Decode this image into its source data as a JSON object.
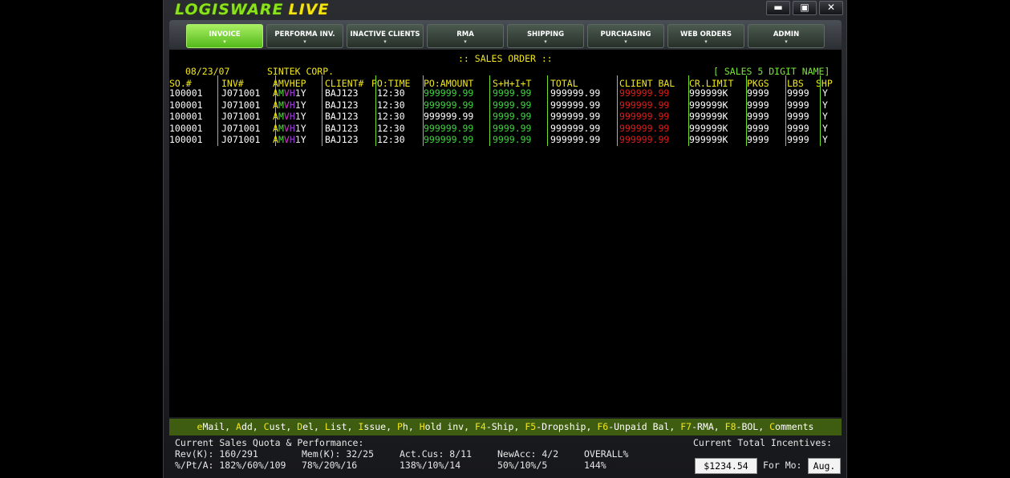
{
  "app": {
    "logo_part1": "LOGISWARE",
    "logo_part2": "LIVE"
  },
  "window_controls": {
    "minimize": "▬",
    "maximize": "▣",
    "close": "✕"
  },
  "nav_tabs": [
    {
      "label": "INVOICE",
      "active": true
    },
    {
      "label": "PERFORMA INV.",
      "active": false
    },
    {
      "label": "INACTIVE CLIENTS",
      "active": false
    },
    {
      "label": "RMA",
      "active": false
    },
    {
      "label": "SHIPPING",
      "active": false
    },
    {
      "label": "PURCHASING",
      "active": false
    },
    {
      "label": "WEB ORDERS",
      "active": false
    },
    {
      "label": "ADMIN",
      "active": false
    }
  ],
  "nav_arrow": "▾",
  "header": {
    "title": ":: SALES ORDER ::",
    "date": "08/23/07",
    "company": "SINTEK CORP.",
    "right": "[ SALES 5 DIGIT NAME]"
  },
  "table": {
    "columns": [
      "SO.#",
      "INV#",
      "AMVHEP",
      "CLIENT#",
      "PO:TIME",
      "PO:AMOUNT",
      "S+H+I+T",
      "TOTAL",
      "CLIENT BAL",
      "CR.LIMIT",
      "PKGS",
      "LBS",
      "SHP"
    ],
    "rows": [
      {
        "so": "100001",
        "inv": "J071001",
        "flags": [
          "A",
          "M",
          "V",
          "H",
          "1",
          "Y"
        ],
        "client": "BAJ123",
        "time": "12:30",
        "po_amount": "999999.99",
        "po_green": true,
        "shit": "9999.99",
        "total": "999999.99",
        "client_bal": "999999.99",
        "cr_limit": "999999K",
        "pkgs": "9999",
        "lbs": "9999",
        "shp": "Y"
      },
      {
        "so": "100001",
        "inv": "J071001",
        "flags": [
          "A",
          "M",
          "V",
          "H",
          "1",
          "Y"
        ],
        "client": "BAJ123",
        "time": "12:30",
        "po_amount": "999999.99",
        "po_green": true,
        "shit": "9999.99",
        "total": "999999.99",
        "client_bal": "999999.99",
        "cr_limit": "999999K",
        "pkgs": "9999",
        "lbs": "9999",
        "shp": "Y"
      },
      {
        "so": "100001",
        "inv": "J071001",
        "flags": [
          "A",
          "M",
          "V",
          "H",
          "1",
          "Y"
        ],
        "client": "BAJ123",
        "time": "12:30",
        "po_amount": "999999.99",
        "po_green": false,
        "shit": "9999.99",
        "total": "999999.99",
        "client_bal": "999999.99",
        "cr_limit": "999999K",
        "pkgs": "9999",
        "lbs": "9999",
        "shp": "Y"
      },
      {
        "so": "100001",
        "inv": "J071001",
        "flags": [
          "A",
          "M",
          "V",
          "H",
          "1",
          "Y"
        ],
        "client": "BAJ123",
        "time": "12:30",
        "po_amount": "999999.99",
        "po_green": true,
        "shit": "9999.99",
        "total": "999999.99",
        "client_bal": "999999.99",
        "cr_limit": "999999K",
        "pkgs": "9999",
        "lbs": "9999",
        "shp": "Y"
      },
      {
        "so": "100001",
        "inv": "J071001",
        "flags": [
          "A",
          "M",
          "V",
          "H",
          "1",
          "Y"
        ],
        "client": "BAJ123",
        "time": "12:30",
        "po_amount": "999999.99",
        "po_green": true,
        "shit": "9999.99",
        "total": "999999.99",
        "client_bal": "999999.99",
        "cr_limit": "999999K",
        "pkgs": "9999",
        "lbs": "9999",
        "shp": "Y"
      }
    ]
  },
  "function_keys": [
    {
      "key": "e",
      "rest": "Mail"
    },
    {
      "key": "A",
      "rest": "dd"
    },
    {
      "key": "C",
      "rest": "ust"
    },
    {
      "key": "D",
      "rest": "el"
    },
    {
      "key": "L",
      "rest": "ist"
    },
    {
      "key": "I",
      "rest": "ssue"
    },
    {
      "key": "P",
      "rest": "h"
    },
    {
      "key": "H",
      "rest": "old inv"
    },
    {
      "key": "F4",
      "rest": "-Ship"
    },
    {
      "key": "F5",
      "rest": "-Dropship"
    },
    {
      "key": "F6",
      "rest": "-Unpaid Bal"
    },
    {
      "key": "F7",
      "rest": "-RMA"
    },
    {
      "key": "F8",
      "rest": "-BOL"
    },
    {
      "key": "C",
      "rest": "omments"
    }
  ],
  "status": {
    "quota_title": "Current Sales Quota & Performance:",
    "incentives_title": "Current Total Incentives:",
    "rev_label": "Rev(K): 160/291",
    "rev_pct": "%/Pt/A: 182%/60%/109",
    "mem_label": "Mem(K): 32/25",
    "mem_pct": "78%/20%/16",
    "act_label": "Act.Cus: 8/11",
    "act_pct": "138%/10%/14",
    "newacc_label": "NewAcc: 4/2",
    "newacc_pct": "50%/10%/5",
    "overall_label": "OVERALL%",
    "overall_pct": "144%",
    "incentive_value": "$1234.54",
    "for_mo_label": "For Mo:",
    "month_value": "Aug."
  }
}
